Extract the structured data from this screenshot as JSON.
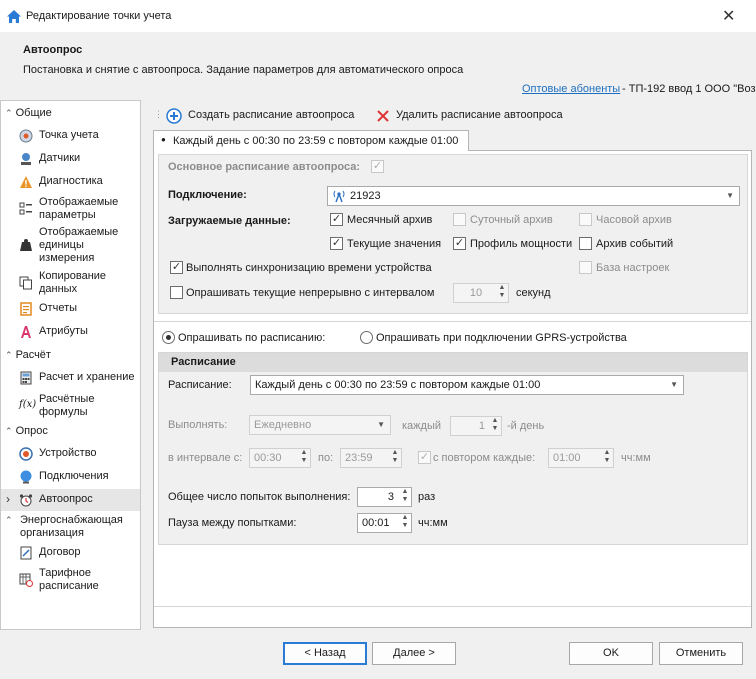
{
  "window": {
    "title": "Редактирование точки учета",
    "close_glyph": "✕"
  },
  "header": {
    "title": "Автоопрос",
    "description": "Постановка и снятие с автоопроса. Задание параметров для автоматического опроса",
    "link": "Оптовые абоненты",
    "path_rest": " - ТП-192 ввод 1  ООО \"Воз"
  },
  "nav": {
    "groups": [
      {
        "label": "Общие",
        "items": [
          "Точка учета",
          "Датчики",
          "Диагностика",
          "Отображаемые параметры",
          "Отображаемые единицы измерения",
          "Копирование данных",
          "Отчеты",
          "Атрибуты"
        ]
      },
      {
        "label": "Расчёт",
        "items": [
          "Расчет и хранение",
          "Расчётные формулы"
        ]
      },
      {
        "label": "Опрос",
        "items": [
          "Устройство",
          "Подключения",
          "Автоопрос"
        ]
      },
      {
        "label": "Энергоснабжающая организация",
        "items": [
          "Договор",
          "Тарифное расписание"
        ]
      }
    ],
    "selected": "Автоопрос"
  },
  "toolbar": {
    "create_label": "Создать расписание автоопроса",
    "delete_label": "Удалить расписание автоопроса"
  },
  "tab": {
    "label": "Каждый день с 00:30 по 23:59 с повтором каждые 01:00"
  },
  "main_schedule": {
    "label": "Основное расписание автоопроса:",
    "checked": true
  },
  "connection": {
    "label": "Подключение:",
    "value": "21923",
    "icon": "antenna-icon"
  },
  "loaded_data": {
    "label": "Загружаемые данные:",
    "options": [
      {
        "label": "Месячный архив",
        "checked": true,
        "enabled": true
      },
      {
        "label": "Суточный архив",
        "checked": false,
        "enabled": false
      },
      {
        "label": "Часовой архив",
        "checked": false,
        "enabled": false
      },
      {
        "label": "Текущие значения",
        "checked": true,
        "enabled": true
      },
      {
        "label": "Профиль мощности",
        "checked": true,
        "enabled": true
      },
      {
        "label": "Архив событий",
        "checked": false,
        "enabled": true
      },
      {
        "label": "База настроек",
        "checked": false,
        "enabled": false
      }
    ]
  },
  "sync_time": {
    "label": "Выполнять синхронизацию времени устройства",
    "checked": true
  },
  "poll_current": {
    "label": "Опрашивать текущие непрерывно с интервалом",
    "checked": false,
    "value": "10",
    "unit": "секунд"
  },
  "poll_mode": {
    "by_schedule": "Опрашивать по расписанию:",
    "on_gprs": "Опрашивать при подключении GPRS-устройства",
    "selected": "by_schedule"
  },
  "schedule": {
    "section_title": "Расписание",
    "label": "Расписание:",
    "value": "Каждый день с 00:30 по 23:59 с повтором каждые 01:00",
    "run_label": "Выполнять:",
    "run_value": "Ежедневно",
    "every_label": "каждый",
    "every_value": "1",
    "day_suffix": "-й день",
    "interval_label": "в интервале с:",
    "from_value": "00:30",
    "to_label": "по:",
    "to_value": "23:59",
    "repeat_label": "с повтором каждые:",
    "repeat_value": "01:00",
    "repeat_unit": "чч:мм",
    "attempts_label": "Общее число попыток выполнения:",
    "attempts_value": "3",
    "attempts_unit": "раз",
    "pause_label": "Пауза между попытками:",
    "pause_value": "00:01",
    "pause_unit": "чч:мм"
  },
  "footer": {
    "back": "< Назад",
    "next": "Далее >",
    "ok": "OK",
    "cancel": "Отменить"
  },
  "colors": {
    "accent": "#1e6fc0",
    "selected_bg": "#e6e6e6",
    "header_bg": "#f0f0f0"
  }
}
